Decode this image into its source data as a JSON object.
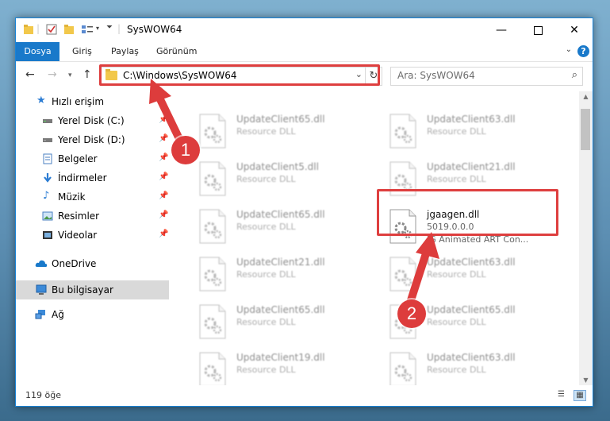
{
  "window": {
    "title": "SysWOW64",
    "accent": "#1979ca"
  },
  "ribbon": {
    "tabs": [
      "Dosya",
      "Giriş",
      "Paylaş",
      "Görünüm"
    ],
    "help_label": "?"
  },
  "nav": {
    "address": "C:\\Windows\\SysWOW64",
    "search_placeholder": "Ara: SysWOW64"
  },
  "sidebar": {
    "items": [
      {
        "label": "Hızlı erişim",
        "icon": "star-icon"
      },
      {
        "label": "Yerel Disk (C:)",
        "icon": "drive-icon",
        "pinned": true
      },
      {
        "label": "Yerel Disk (D:)",
        "icon": "drive-icon",
        "pinned": true
      },
      {
        "label": "Belgeler",
        "icon": "documents-icon",
        "pinned": true
      },
      {
        "label": "İndirmeler",
        "icon": "download-icon",
        "pinned": true
      },
      {
        "label": "Müzik",
        "icon": "music-icon",
        "pinned": true
      },
      {
        "label": "Resimler",
        "icon": "pictures-icon",
        "pinned": true
      },
      {
        "label": "Videolar",
        "icon": "videos-icon",
        "pinned": true
      },
      {
        "label": "OneDrive",
        "icon": "cloud-icon"
      },
      {
        "label": "Bu bilgisayar",
        "icon": "computer-icon",
        "selected": true
      },
      {
        "label": "Ağ",
        "icon": "network-icon"
      }
    ]
  },
  "files": [
    {
      "name": "UpdateClient65.dll",
      "desc": "Resource DLL"
    },
    {
      "name": "UpdateClient63.dll",
      "desc": "Resource DLL"
    },
    {
      "name": "UpdateClient5.dll",
      "desc": "Resource DLL"
    },
    {
      "name": "UpdateClient21.dll",
      "desc": "Resource DLL"
    },
    {
      "name": "UpdateClient65.dll",
      "desc": "Resource DLL"
    },
    {
      "name": "jgaagen.dll",
      "version": "5019.0.0.0",
      "desc": "JG Animated ART Con..."
    },
    {
      "name": "UpdateClient21.dll",
      "desc": "Resource DLL"
    },
    {
      "name": "UpdateClient63.dll",
      "desc": "Resource DLL"
    },
    {
      "name": "UpdateClient65.dll",
      "desc": "Resource DLL"
    },
    {
      "name": "UpdateClient65.dll",
      "desc": "Resource DLL"
    },
    {
      "name": "UpdateClient19.dll",
      "desc": "Resource DLL"
    },
    {
      "name": "UpdateClient63.dll",
      "desc": "Resource DLL"
    }
  ],
  "status": {
    "count_text": "119 öğe"
  },
  "annotations": {
    "badge1": "1",
    "badge2": "2",
    "highlight_color": "#de3f3f"
  }
}
